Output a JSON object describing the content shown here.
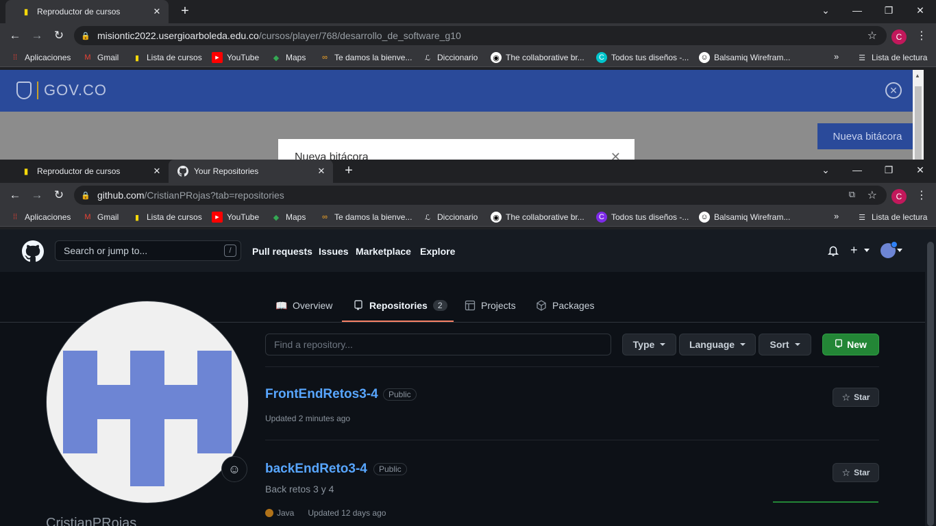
{
  "window1": {
    "tabs": [
      {
        "title": "Reproductor de cursos",
        "active": true
      }
    ],
    "url_host": "misiontic2022.usergioarboleda.edu.co",
    "url_path": "/cursos/player/768/desarrollo_de_software_g10",
    "profile_initial": "C",
    "gov_logo_text": "GOV.CO",
    "new_log_button": "Nueva bitácora",
    "modal_title": "Nueva bitácora"
  },
  "window2": {
    "tabs": [
      {
        "title": "Reproductor de cursos",
        "active": false
      },
      {
        "title": "Your Repositories",
        "active": true
      }
    ],
    "url_host": "github.com",
    "url_path": "/CristianPRojas?tab=repositories",
    "profile_initial": "C"
  },
  "bookmarks": {
    "items": [
      {
        "label": "Aplicaciones",
        "icon": "apps-grid-icon"
      },
      {
        "label": "Gmail",
        "icon": "gmail-icon"
      },
      {
        "label": "Lista de cursos",
        "icon": "book-icon"
      },
      {
        "label": "YouTube",
        "icon": "youtube-icon"
      },
      {
        "label": "Maps",
        "icon": "maps-icon"
      },
      {
        "label": "Te damos la bienve...",
        "icon": "infinity-icon"
      },
      {
        "label": "Diccionario",
        "icon": "dictionary-icon"
      },
      {
        "label": "The collaborative br...",
        "icon": "collab-icon"
      },
      {
        "label": "Todos tus diseños -...",
        "icon": "canva-icon"
      },
      {
        "label": "Balsamiq Wirefram...",
        "icon": "balsamiq-icon"
      }
    ],
    "more": "»",
    "reading_list": "Lista de lectura"
  },
  "github": {
    "search_placeholder": "Search or jump to...",
    "search_shortcut": "/",
    "nav": [
      "Pull requests",
      "Issues",
      "Marketplace",
      "Explore"
    ],
    "profile_tabs": [
      {
        "label": "Overview"
      },
      {
        "label": "Repositories",
        "count": "2"
      },
      {
        "label": "Projects"
      },
      {
        "label": "Packages"
      }
    ],
    "find_placeholder": "Find a repository...",
    "filters": [
      "Type",
      "Language",
      "Sort"
    ],
    "new_button": "New",
    "username": "CristianPRojas",
    "repos": [
      {
        "name": "FrontEndRetos3-4",
        "visibility": "Public",
        "description": "",
        "language": "",
        "updated": "Updated 2 minutes ago",
        "star_label": "Star"
      },
      {
        "name": "backEndReto3-4",
        "visibility": "Public",
        "description": "Back retos 3 y 4",
        "language": "Java",
        "language_color": "#b07219",
        "updated": "Updated 12 days ago",
        "star_label": "Star"
      }
    ]
  },
  "colors": {
    "github_bg": "#0d1117",
    "github_header": "#161b22",
    "link": "#58a6ff",
    "accent_tab": "#f78166",
    "new_button": "#238636",
    "gov_blue": "#2a4a9a",
    "avatar_blue": "#6d85d4"
  }
}
